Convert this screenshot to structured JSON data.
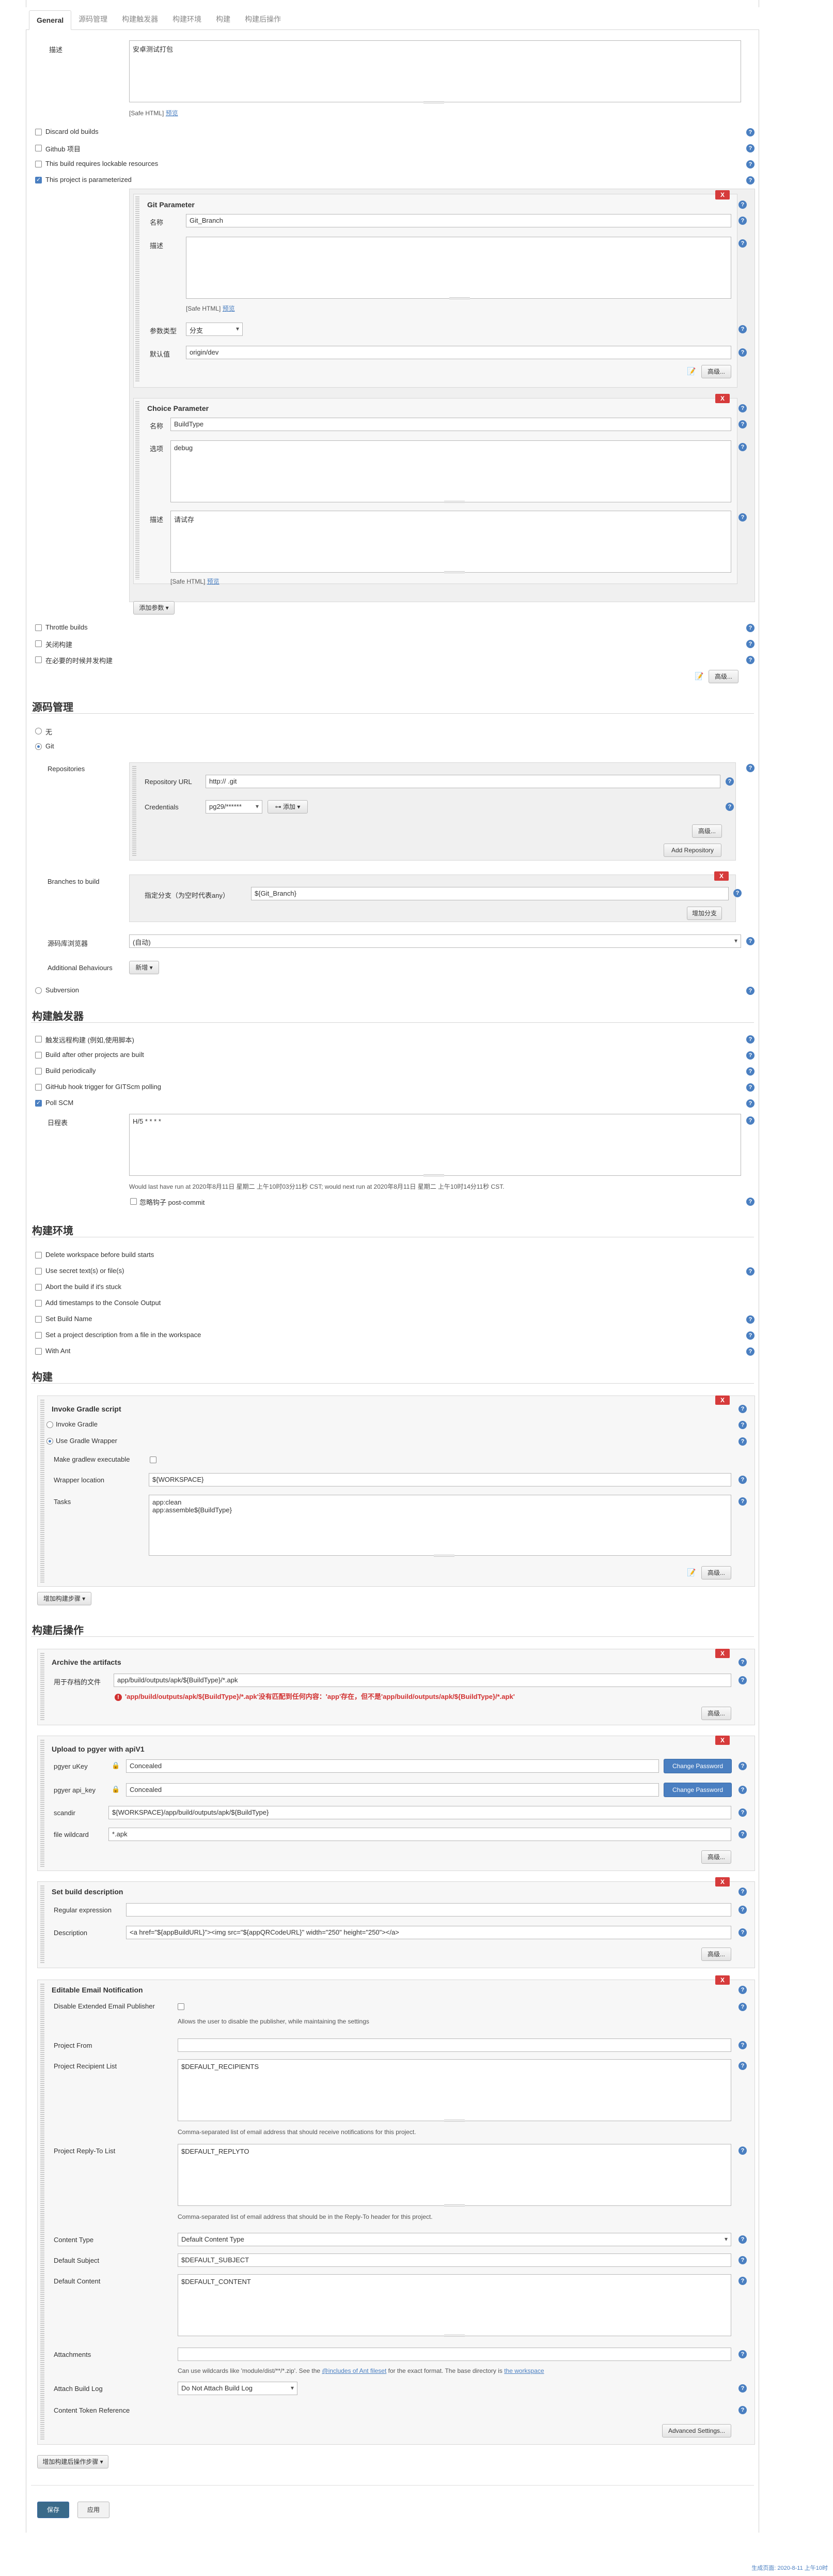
{
  "tabs": [
    "General",
    "源码管理",
    "构建触发器",
    "构建环境",
    "构建",
    "构建后操作"
  ],
  "general": {
    "desc_label": "描述",
    "desc_value": "安卓测试打包",
    "safe_html": "[Safe HTML]",
    "preview": "预览",
    "options": [
      {
        "label": "Discard old builds",
        "checked": false
      },
      {
        "label": "Github 项目",
        "checked": false
      },
      {
        "label": "This build requires lockable resources",
        "checked": false
      },
      {
        "label": "This project is parameterized",
        "checked": true
      }
    ],
    "git_param": {
      "title": "Git Parameter",
      "name_label": "名称",
      "name_value": "Git_Branch",
      "desc_label": "描述",
      "safe_html": "[Safe HTML]",
      "preview": "预览",
      "type_label": "参数类型",
      "type_value": "分支",
      "default_label": "默认值",
      "default_value": "origin/dev",
      "advanced": "高级..."
    },
    "choice_param": {
      "title": "Choice Parameter",
      "name_label": "名称",
      "name_value": "BuildType",
      "choices_label": "选项",
      "choices_value": "debug",
      "desc_label": "描述",
      "desc_value": "请试存",
      "safe_html": "[Safe HTML]",
      "preview": "预览"
    },
    "add_param": "添加参数",
    "more_options": [
      {
        "label": "Throttle builds",
        "checked": false
      },
      {
        "label": "关闭构建",
        "checked": false
      },
      {
        "label": "在必要的时候并发构建",
        "checked": false
      }
    ],
    "advanced": "高级..."
  },
  "scm": {
    "title": "源码管理",
    "none": "无",
    "git": "Git",
    "repos_label": "Repositories",
    "repo_url_label": "Repository URL",
    "repo_url_value": "http://                                                       .git",
    "cred_label": "Credentials",
    "cred_value": "pg29/******",
    "add_label": "添加",
    "advanced": "高级...",
    "add_repo": "Add Repository",
    "branches_label": "Branches to build",
    "branch_spec_label": "指定分支（为空时代表any）",
    "branch_spec_value": "${Git_Branch}",
    "add_branch": "增加分支",
    "browser_label": "源码库浏览器",
    "browser_value": "(自动)",
    "behaviours_label": "Additional Behaviours",
    "behaviours_add": "新增",
    "subversion": "Subversion"
  },
  "triggers": {
    "title": "构建触发器",
    "options": [
      {
        "label": "触发远程构建 (例如,使用脚本)",
        "checked": false
      },
      {
        "label": "Build after other projects are built",
        "checked": false
      },
      {
        "label": "Build periodically",
        "checked": false
      },
      {
        "label": "GitHub hook trigger for GITScm polling",
        "checked": false
      },
      {
        "label": "Poll SCM",
        "checked": true
      }
    ],
    "schedule_label": "日程表",
    "schedule_value": "H/5 * * * *",
    "schedule_note": "Would last have run at 2020年8月11日 星期二 上午10时03分11秒 CST; would next run at 2020年8月11日 星期二 上午10时14分11秒 CST.",
    "ignore_hooks": "忽略钩子 post-commit"
  },
  "env": {
    "title": "构建环境",
    "options": [
      {
        "label": "Delete workspace before build starts",
        "checked": false
      },
      {
        "label": "Use secret text(s) or file(s)",
        "checked": false
      },
      {
        "label": "Abort the build if it's stuck",
        "checked": false
      },
      {
        "label": "Add timestamps to the Console Output",
        "checked": false
      },
      {
        "label": "Set Build Name",
        "checked": false
      },
      {
        "label": "Set a project description from a file in the workspace",
        "checked": false
      },
      {
        "label": "With Ant",
        "checked": false
      }
    ]
  },
  "build": {
    "title": "构建",
    "step_title": "Invoke Gradle script",
    "invoke_gradle": "Invoke Gradle",
    "use_wrapper": "Use Gradle Wrapper",
    "make_exec": "Make gradlew executable",
    "wrapper_loc_label": "Wrapper location",
    "wrapper_loc_value": "${WORKSPACE}",
    "tasks_label": "Tasks",
    "tasks_value": "app:clean\napp:assemble${BuildType}",
    "advanced": "高级...",
    "add_step": "增加构建步骤"
  },
  "post": {
    "title": "构建后操作",
    "archive": {
      "title": "Archive the artifacts",
      "files_label": "用于存档的文件",
      "files_value": "app/build/outputs/apk/${BuildType}/*.apk",
      "error": "'app/build/outputs/apk/${BuildType}/*.apk'没有匹配到任何内容：'app'存在，但不是'app/build/outputs/apk/${BuildType}/*.apk'",
      "advanced": "高级..."
    },
    "pgyer": {
      "title": "Upload to pgyer with apiV1",
      "ukey_label": "pgyer uKey",
      "ukey_value": "Concealed",
      "apikey_label": "pgyer api_key",
      "apikey_value": "Concealed",
      "change_pw": "Change Password",
      "scandir_label": "scandir",
      "scandir_value": "${WORKSPACE}/app/build/outputs/apk/${BuildType}",
      "wildcard_label": "file wildcard",
      "wildcard_value": "*.apk",
      "advanced": "高级..."
    },
    "desc": {
      "title": "Set build description",
      "regex_label": "Regular expression",
      "desc_label": "Description",
      "desc_value": "<a href=\"${appBuildURL}\"><img src=\"${appQRCodeURL}\" width=\"250\" height=\"250\"></a>",
      "advanced": "高级..."
    },
    "email": {
      "title": "Editable Email Notification",
      "disable_label": "Disable Extended Email Publisher",
      "disable_note": "Allows the user to disable the publisher, while maintaining the settings",
      "from_label": "Project From",
      "recipients_label": "Project Recipient List",
      "recipients_value": "$DEFAULT_RECIPIENTS",
      "recipients_note": "Comma-separated list of email address that should receive notifications for this project.",
      "replyto_label": "Project Reply-To List",
      "replyto_value": "$DEFAULT_REPLYTO",
      "replyto_note": "Comma-separated list of email address that should be in the Reply-To header for this project.",
      "content_type_label": "Content Type",
      "content_type_value": "Default Content Type",
      "subject_label": "Default Subject",
      "subject_value": "$DEFAULT_SUBJECT",
      "content_label": "Default Content",
      "content_value": "$DEFAULT_CONTENT",
      "attachments_label": "Attachments",
      "attachments_note_pre": "Can use wildcards like 'module/dist/**/*.zip'. See the ",
      "attachments_link": "@includes of Ant fileset",
      "attachments_note_mid": " for the exact format. The base directory is ",
      "attachments_link2": "the workspace",
      "attach_log_label": "Attach Build Log",
      "attach_log_value": "Do Not Attach Build Log",
      "token_label": "Content Token Reference",
      "advanced": "Advanced Settings..."
    },
    "add_step": "增加构建后操作步骤"
  },
  "save": "保存",
  "apply": "应用",
  "footer": "生成页面: 2020-8-11 上午10时"
}
